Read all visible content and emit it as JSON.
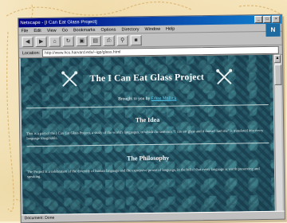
{
  "window": {
    "title": "Netscape - [I Can Eat Glass Project]"
  },
  "menubar": [
    "File",
    "Edit",
    "View",
    "Go",
    "Bookmarks",
    "Options",
    "Directory",
    "Window",
    "Help"
  ],
  "toolbar": {
    "icons": [
      "back-icon",
      "forward-icon",
      "home-icon",
      "reload-icon",
      "images-icon",
      "open-icon",
      "print-icon",
      "find-icon",
      "stop-icon"
    ]
  },
  "addressbar": {
    "label": "Location:",
    "url": "http://www.hcs.harvard.edu/~igp/glass.html"
  },
  "page": {
    "title": "The I Can Eat Glass Project",
    "byline_prefix": "Brought to you by",
    "byline_link": "Ethan Mollick",
    "sections": [
      {
        "heading": "The Idea",
        "text": "This is a part of the I Can Eat Glass Project, a study of the world's languages, in which the sentence \"I can eat glass and it doesn't hurt me\" is translated into every language imaginable."
      },
      {
        "heading": "The Philosophy",
        "text": "The Project is a celebration of the diversity of human language and the expressive power of language, in the belief that every language is worth preserving and speaking."
      }
    ]
  },
  "status": {
    "text": "Document: Done"
  }
}
